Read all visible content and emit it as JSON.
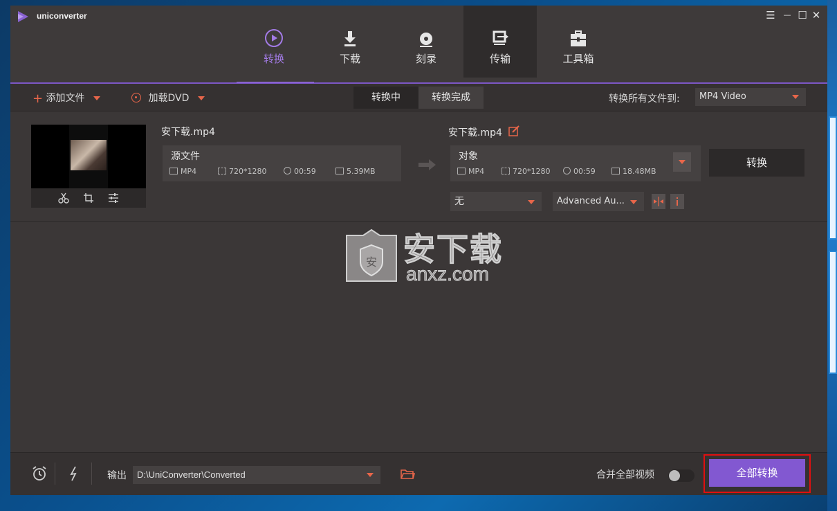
{
  "app": {
    "title": "uniconverter"
  },
  "window_controls": {
    "menu": "☰",
    "minimize": "—",
    "maximize": "☐",
    "close": "✕"
  },
  "nav": [
    {
      "label": "转换",
      "icon": "play-circle-icon",
      "selected": true
    },
    {
      "label": "下载",
      "icon": "download-icon",
      "selected": false
    },
    {
      "label": "刻录",
      "icon": "disc-icon",
      "selected": false
    },
    {
      "label": "传输",
      "icon": "transfer-icon",
      "selected": false
    },
    {
      "label": "工具箱",
      "icon": "toolbox-icon",
      "selected": false
    }
  ],
  "toolbar": {
    "add_file": "添加文件",
    "load_dvd": "加载DVD",
    "tab_converting": "转换中",
    "tab_done": "转换完成",
    "convert_all_to": "转换所有文件到:",
    "format": "MP4 Video"
  },
  "file": {
    "source_name": "安下载.mp4",
    "target_name": "安下载.mp4",
    "source": {
      "title": "源文件",
      "format": "MP4",
      "resolution": "720*1280",
      "duration": "00:59",
      "size": "5.39MB"
    },
    "target": {
      "title": "对象",
      "format": "MP4",
      "resolution": "720*1280",
      "duration": "00:59",
      "size": "18.48MB"
    },
    "convert_button": "转换",
    "subtitle": "无",
    "audio": "Advanced Au..."
  },
  "watermark": {
    "text_cn": "安下载",
    "text_en": "anxz.com"
  },
  "bottom": {
    "output_label": "输出",
    "output_path": "D:\\UniConverter\\Converted",
    "merge_label": "合并全部视频",
    "convert_all": "全部转换"
  },
  "colors": {
    "accent": "#8258d1",
    "orange": "#e8664a",
    "bg": "#3b3737"
  }
}
